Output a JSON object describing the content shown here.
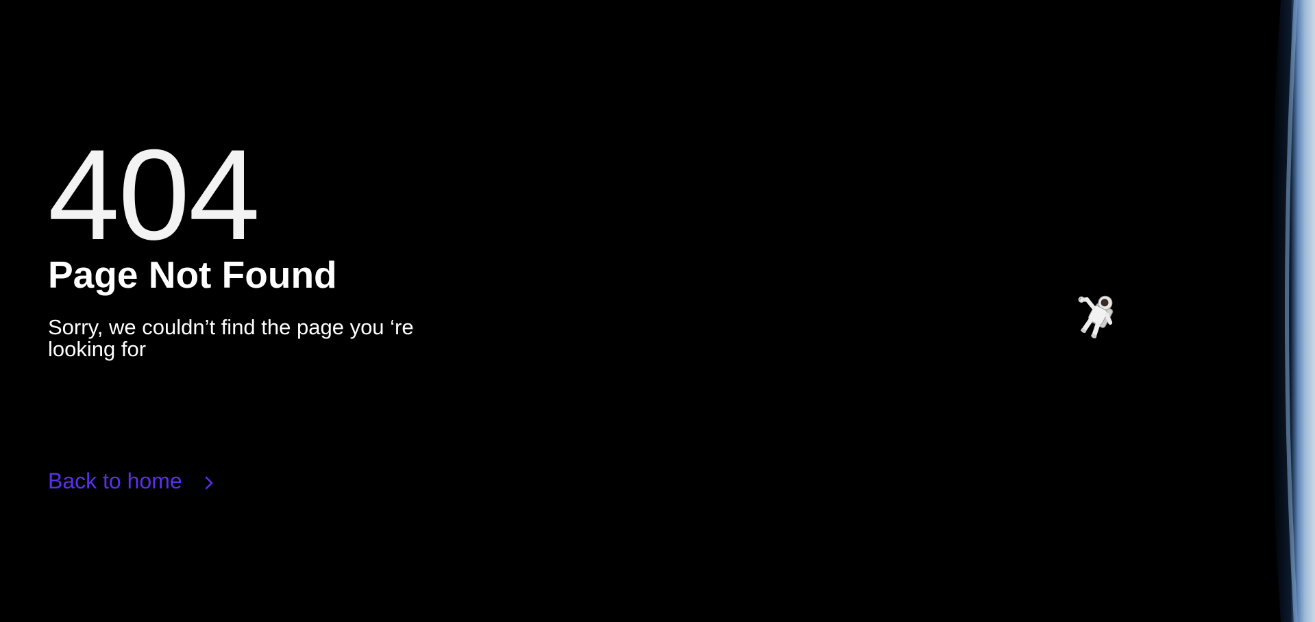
{
  "error": {
    "code": "404",
    "title": "Page Not Found",
    "message": "Sorry, we couldn’t find the page you ‘re looking for"
  },
  "navigation": {
    "back_label": "Back to home",
    "back_icon": "chevron-right-icon"
  },
  "background": {
    "scene": "space",
    "decorations": [
      "astronaut-illustration",
      "earth-horizon"
    ]
  },
  "colors": {
    "background": "#000000",
    "text": "#ffffff",
    "link": "#5b2ff2"
  }
}
